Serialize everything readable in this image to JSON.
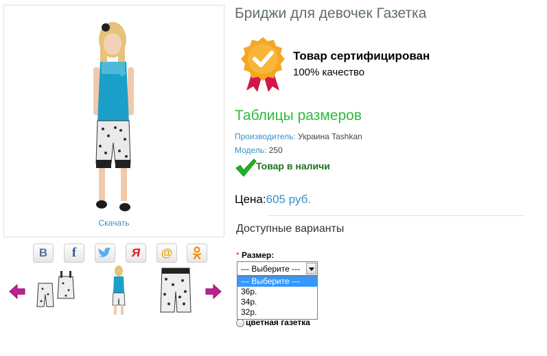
{
  "product": {
    "title": "Бриджи для девочек Газетка",
    "download_label": "Скачать"
  },
  "certificate": {
    "title": "Товар сертифицирован",
    "subtitle": "100% качество"
  },
  "size_table_label": "Таблицы размеров",
  "info": {
    "maker_key": "Производитель:",
    "maker_value": "Украина Tashkan",
    "model_key": "Модель:",
    "model_value": "250"
  },
  "stock_label": "Товар в наличи",
  "price": {
    "label": "Цена:",
    "value": "605 руб."
  },
  "variants_title": "Доступные варианты",
  "size_option": {
    "required_mark": "*",
    "label": "Размер:",
    "selected": "--- Выберите ---",
    "options": [
      "--- Выберите ---",
      "36р.",
      "34р.",
      "32р."
    ]
  },
  "color_option": {
    "label": "цветная газетка"
  },
  "social": [
    "vk-icon",
    "facebook-icon",
    "twitter-icon",
    "yandex-icon",
    "mail-ru-icon",
    "odnoklassniki-icon"
  ],
  "colors": {
    "accent_blue": "#3a8fc8",
    "green_title": "#2db83d",
    "arrow_magenta": "#c0208e",
    "badge_gold": "#f5a623",
    "badge_ribbon": "#d0174a"
  }
}
